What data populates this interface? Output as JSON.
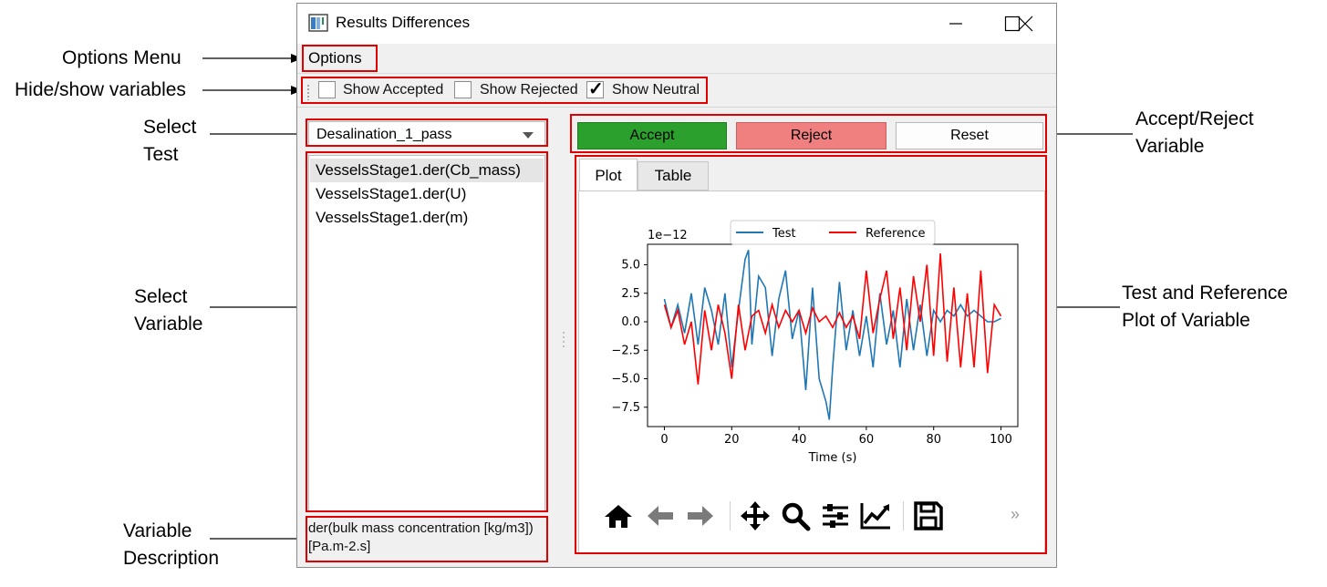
{
  "annotations": {
    "options_menu": "Options Menu",
    "hide_show": "Hide/show variables",
    "select_test": [
      "Select",
      "Test"
    ],
    "select_variable": [
      "Select",
      "Variable"
    ],
    "variable_description": [
      "Variable",
      "Description"
    ],
    "accept_reject": [
      "Accept/Reject",
      "Variable"
    ],
    "test_reference": [
      "Test and Reference",
      "Plot of Variable"
    ]
  },
  "window": {
    "title": "Results Differences"
  },
  "menu": {
    "options": "Options"
  },
  "toolbar": {
    "show_accepted": {
      "label": "Show Accepted",
      "checked": false
    },
    "show_rejected": {
      "label": "Show Rejected",
      "checked": false
    },
    "show_neutral": {
      "label": "Show Neutral",
      "checked": true
    }
  },
  "test_select": {
    "value": "Desalination_1_pass"
  },
  "variables": [
    "VesselsStage1.der(Cb_mass)",
    "VesselsStage1.der(U)",
    "VesselsStage1.der(m)"
  ],
  "selected_variable_index": 0,
  "description": "der(bulk mass concentration [kg/m3]) [Pa.m-2.s]",
  "buttons": {
    "accept": "Accept",
    "reject": "Reject",
    "reset": "Reset",
    "accept_color": "#2ca02c",
    "reject_color": "#f08080"
  },
  "tabs": {
    "plot": "Plot",
    "table": "Table",
    "active": "Plot"
  },
  "navbar_icons": [
    "home-icon",
    "back-arrow-icon",
    "forward-arrow-icon",
    "pan-icon",
    "zoom-icon",
    "subplots-config-icon",
    "axes-edit-icon",
    "save-icon",
    "more-chevron-icon"
  ],
  "navbar_more": "»",
  "chart_data": {
    "type": "line",
    "title": "",
    "xlabel": "Time (s)",
    "ylabel": "",
    "offset_text": "1e−12",
    "xlim": [
      -5,
      105
    ],
    "ylim": [
      -9.2,
      6.8
    ],
    "xticks": [
      0,
      20,
      40,
      60,
      80,
      100
    ],
    "yticks": [
      -7.5,
      -5.0,
      -2.5,
      0.0,
      2.5,
      5.0
    ],
    "ytick_labels": [
      "−7.5",
      "−5.0",
      "−2.5",
      "0.0",
      "2.5",
      "5.0"
    ],
    "legend_position": "top-center",
    "series": [
      {
        "name": "Test",
        "color": "#1f77b4",
        "x": [
          0,
          2,
          4,
          6,
          8,
          10,
          12,
          14,
          16,
          18,
          20,
          22,
          24,
          25,
          26,
          28,
          30,
          32,
          34,
          36,
          38,
          40,
          42,
          44,
          46,
          48,
          49,
          50,
          52,
          54,
          56,
          58,
          60,
          62,
          64,
          66,
          68,
          70,
          72,
          74,
          76,
          78,
          80,
          82,
          84,
          86,
          88,
          90,
          92,
          94,
          96,
          98,
          100
        ],
        "y": [
          2.0,
          -0.5,
          1.5,
          -1.0,
          2.5,
          -2.0,
          3.0,
          1.0,
          -2.0,
          2.5,
          -4.0,
          1.0,
          5.5,
          6.3,
          -2.0,
          4.0,
          3.0,
          -3.0,
          2.0,
          4.5,
          -1.5,
          1.0,
          -6.0,
          3.0,
          -5.0,
          -7.0,
          -8.6,
          -4.0,
          3.5,
          -2.5,
          1.0,
          -3.0,
          0.5,
          -4.0,
          2.5,
          -2.0,
          1.0,
          -4.0,
          2.0,
          -2.5,
          1.5,
          -3.0,
          1.0,
          0.0,
          1.0,
          0.5,
          1.5,
          0.5,
          1.0,
          0.5,
          0.0,
          0.0,
          0.3
        ]
      },
      {
        "name": "Reference",
        "color": "#ff0000",
        "x": [
          0,
          2,
          4,
          6,
          8,
          10,
          12,
          14,
          16,
          18,
          20,
          22,
          24,
          26,
          28,
          30,
          32,
          34,
          36,
          38,
          40,
          42,
          44,
          46,
          48,
          50,
          52,
          54,
          56,
          58,
          60,
          62,
          64,
          66,
          68,
          70,
          72,
          74,
          76,
          78,
          80,
          82,
          84,
          86,
          88,
          90,
          92,
          94,
          96,
          98,
          100
        ],
        "y": [
          1.5,
          -0.5,
          1.0,
          -2.0,
          0.0,
          -5.5,
          1.0,
          -2.5,
          1.5,
          -1.0,
          -5.0,
          1.5,
          -2.5,
          0.5,
          1.0,
          -1.0,
          1.5,
          -0.5,
          1.0,
          0.0,
          1.0,
          -1.0,
          1.2,
          0.0,
          0.5,
          -0.5,
          0.8,
          -0.5,
          0.5,
          -1.5,
          4.5,
          -1.0,
          2.0,
          4.5,
          -1.5,
          3.0,
          -2.5,
          4.0,
          0.0,
          5.0,
          -3.0,
          6.0,
          -3.5,
          3.0,
          -4.0,
          2.5,
          -4.0,
          4.5,
          -4.5,
          1.5,
          0.5
        ]
      }
    ]
  }
}
